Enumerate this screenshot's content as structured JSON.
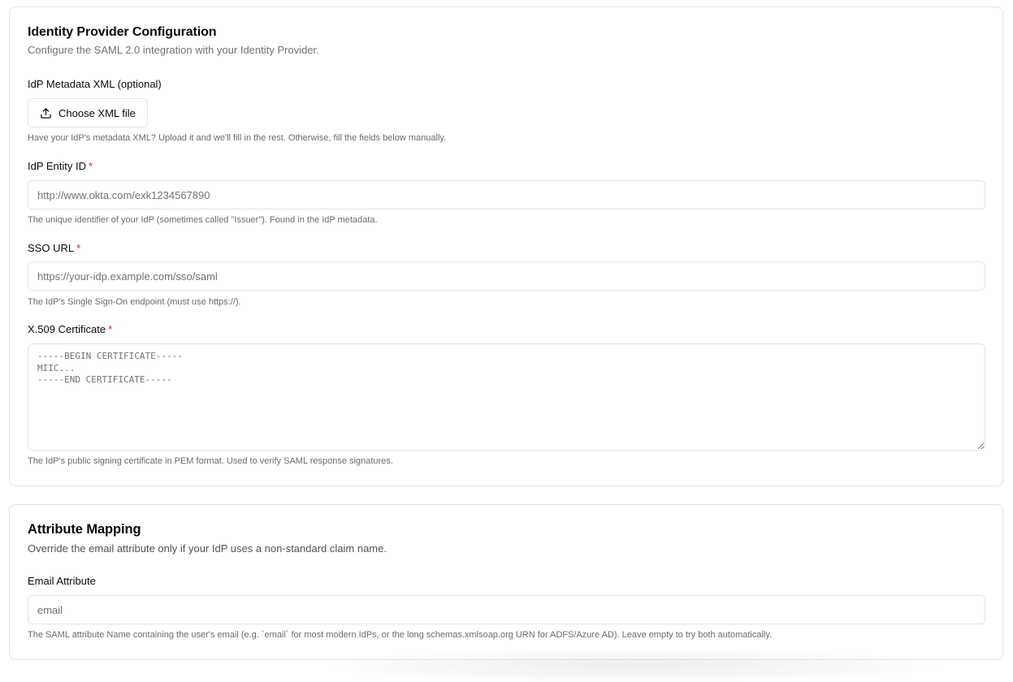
{
  "idp_config": {
    "title": "Identity Provider Configuration",
    "description": "Configure the SAML 2.0 integration with your Identity Provider.",
    "metadata": {
      "label": "IdP Metadata XML (optional)",
      "button_label": "Choose XML file",
      "button_icon": "upload-icon",
      "hint": "Have your IdP's metadata XML? Upload it and we'll fill in the rest. Otherwise, fill the fields below manually."
    },
    "entity_id": {
      "label": "IdP Entity ID",
      "required_mark": "*",
      "placeholder": "http://www.okta.com/exk1234567890",
      "value": "",
      "hint": "The unique identifier of your IdP (sometimes called \"Issuer\"). Found in the IdP metadata."
    },
    "sso_url": {
      "label": "SSO URL",
      "required_mark": "*",
      "placeholder": "https://your-idp.example.com/sso/saml",
      "value": "",
      "hint": "The IdP's Single Sign-On endpoint (must use https://)."
    },
    "certificate": {
      "label": "X.509 Certificate",
      "required_mark": "*",
      "placeholder": "-----BEGIN CERTIFICATE-----\nMIIC...\n-----END CERTIFICATE-----",
      "value": "",
      "hint": "The IdP's public signing certificate in PEM format. Used to verify SAML response signatures."
    }
  },
  "attribute_mapping": {
    "title": "Attribute Mapping",
    "description": "Override the email attribute only if your IdP uses a non-standard claim name.",
    "email_attribute": {
      "label": "Email Attribute",
      "placeholder": "email",
      "value": "",
      "hint": "The SAML attribute Name containing the user's email (e.g. `email` for most modern IdPs, or the long schemas.xmlsoap.org URN for ADFS/Azure AD). Leave empty to try both automatically."
    }
  },
  "colors": {
    "border": "#e4e4e7",
    "required": "#dc2626",
    "muted_text": "#71717a"
  }
}
